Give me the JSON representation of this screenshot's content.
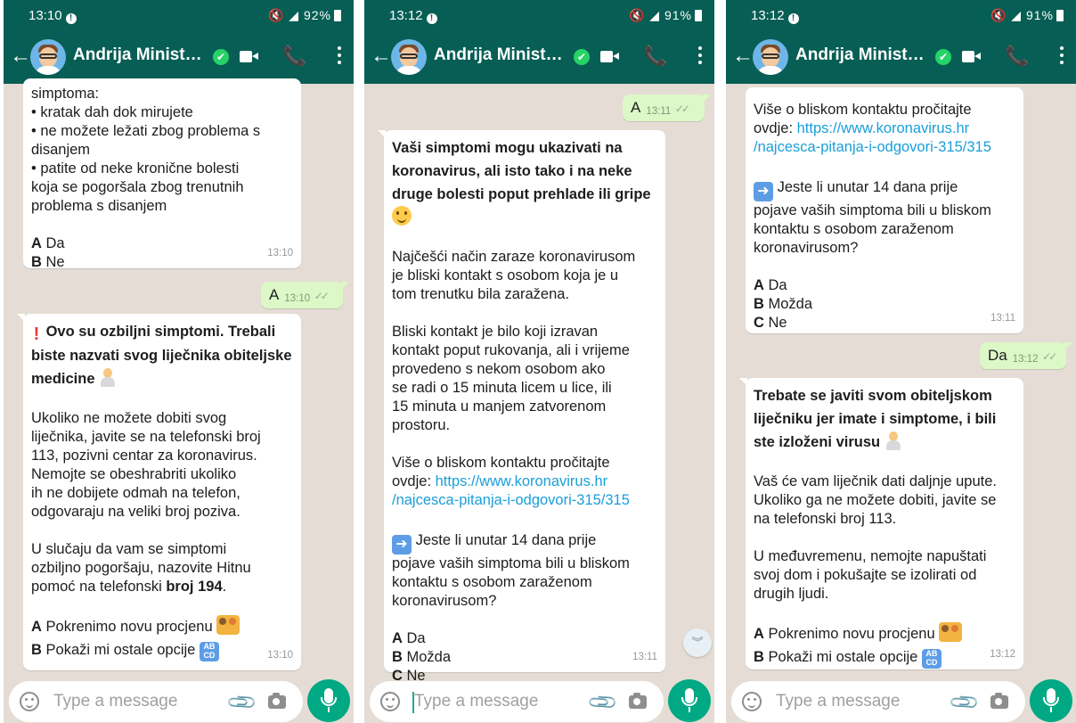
{
  "colors": {
    "header": "#075e54",
    "chat_bg": "#e5ddd5",
    "outgoing": "#dcf8c6",
    "link": "#1a9fd8",
    "mic": "#00a884"
  },
  "icons": [
    "back-arrow-icon",
    "verified-icon",
    "video-call-icon",
    "phone-icon",
    "more-options-icon",
    "emoji-icon",
    "attach-icon",
    "camera-icon",
    "microphone-icon",
    "scroll-down-icon"
  ],
  "common": {
    "contact_name": "Andrija Minist…",
    "back_icon": "←",
    "verified_icon": "✔",
    "call_icon": "📞",
    "input_placeholder": "Type a message",
    "attach_icon": "📎",
    "scroll_icon": "︾"
  },
  "screens": [
    {
      "status_time": "13:10",
      "status_icons": "🔇 ◢ ",
      "battery": "92%",
      "messages": {
        "m1": {
          "lines": [
            "simptoma:",
            "• kratak dah dok mirujete",
            "• ne možete ležati zbog problema s",
            "disanjem",
            "• patite od neke kronične bolesti",
            "koja se pogoršala zbog trenutnih",
            "problema s disanjem"
          ],
          "opt_a_key": "A",
          "opt_a": "Da",
          "opt_b_key": "B",
          "opt_b": "Ne",
          "time": "13:10"
        },
        "m2": {
          "text": "A",
          "time": "13:10"
        },
        "m3": {
          "title_lines": [
            "Ovo su ozbiljni simptomi. Trebali",
            "biste nazvati svog liječnika obiteljske",
            "medicine"
          ],
          "p1": [
            "Ukoliko ne možete dobiti svog",
            "liječnika, javite se na telefonski broj",
            "113, pozivni centar za koronavirus.",
            "Nemojte se obeshrabriti ukoliko",
            "ih ne dobijete odmah na telefon,",
            "odgovaraju na veliki broj poziva."
          ],
          "p2_l1": "U slučaju da vam se simptomi",
          "p2_l2": "ozbiljno pogoršaju, nazovite Hitnu",
          "p2_l3_a": "pomoć na telefonski ",
          "p2_l3_b": "broj 194",
          "p2_l3_c": ".",
          "opt_a_key": "A",
          "opt_a": "Pokrenimo novu procjenu",
          "opt_b_key": "B",
          "opt_b": "Pokaži mi ostale opcije",
          "time": "13:10"
        }
      }
    },
    {
      "status_time": "13:12",
      "status_icons": "🔇 ◢ ",
      "battery": "91%",
      "messages": {
        "m1": {
          "text": "A",
          "time": "13:11"
        },
        "m2": {
          "title_lines": [
            "Vaši simptomi mogu ukazivati na",
            "koronavirus, ali isto tako i na neke",
            "druge bolesti poput prehlade ili gripe"
          ],
          "p1": [
            "Najčešći način zaraze koronavirusom",
            "je bliski kontakt s osobom koja je u",
            "tom trenutku bila zaražena."
          ],
          "p2": [
            "Bliski kontakt je bilo koji izravan",
            "kontakt poput rukovanja, ali i vrijeme",
            "provedeno s nekom osobom ako",
            "se radi o 15 minuta licem u lice, ili",
            "15 minuta u manjem zatvorenom",
            "prostoru."
          ],
          "p3_l1": "Više o bliskom kontaktu pročitajte",
          "p3_l2_a": "ovdje: ",
          "p3_link1": "https://www.koronavirus.hr",
          "p3_link2": "/najcesca-pitanja-i-odgovori-315/315",
          "q_l1": "Jeste li unutar 14 dana prije",
          "q_lines": [
            "pojave vaših simptoma bili u bliskom",
            "kontaktu s osobom zaraženom",
            "koronavirusom?"
          ],
          "opt_a_key": "A",
          "opt_a": "Da",
          "opt_b_key": "B",
          "opt_b": "Možda",
          "opt_c_key": "C",
          "opt_c": "Ne",
          "time": "13:11"
        }
      }
    },
    {
      "status_time": "13:12",
      "status_icons": "🔇 ◢ ",
      "battery": "91%",
      "messages": {
        "m1": {
          "l1": "Više o bliskom kontaktu pročitajte",
          "l2_a": "ovdje: ",
          "link1": "https://www.koronavirus.hr",
          "link2": "/najcesca-pitanja-i-odgovori-315/315",
          "q_l1": "Jeste li unutar 14 dana prije",
          "q_lines": [
            "pojave vaših simptoma bili u bliskom",
            "kontaktu s osobom zaraženom",
            "koronavirusom?"
          ],
          "opt_a_key": "A",
          "opt_a": "Da",
          "opt_b_key": "B",
          "opt_b": "Možda",
          "opt_c_key": "C",
          "opt_c": "Ne",
          "time": "13:11"
        },
        "m2": {
          "text": "Da",
          "time": "13:12"
        },
        "m3": {
          "title_lines": [
            "Trebate se javiti svom obiteljskom",
            "liječniku jer imate i simptome, i bili",
            "ste izloženi virusu"
          ],
          "p1": [
            "Vaš će vam liječnik dati daljnje upute.",
            "Ukoliko ga ne možete dobiti, javite se",
            "na telefonski broj 113."
          ],
          "p2": [
            "U međuvremenu, nemojte napuštati",
            "svoj dom i pokušajte se izolirati od",
            "drugih ljudi."
          ],
          "opt_a_key": "A",
          "opt_a": "Pokrenimo novu procjenu",
          "opt_b_key": "B",
          "opt_b": "Pokaži mi ostale opcije",
          "time": "13:12"
        }
      }
    }
  ]
}
